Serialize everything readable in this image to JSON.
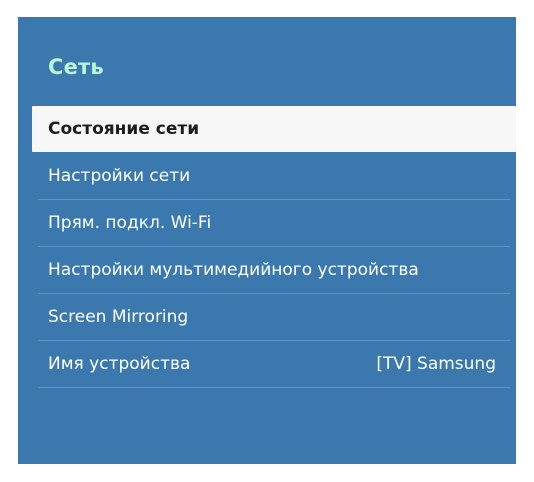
{
  "menu": {
    "title": "Сеть",
    "items": [
      {
        "label": "Состояние сети",
        "value": "",
        "selected": true
      },
      {
        "label": "Настройки сети",
        "value": ""
      },
      {
        "label": "Прям. подкл. Wi-Fi",
        "value": ""
      },
      {
        "label": "Настройки мультимедийного устройства",
        "value": ""
      },
      {
        "label": "Screen Mirroring",
        "value": ""
      },
      {
        "label": "Имя устройства",
        "value": "[TV] Samsung"
      }
    ]
  },
  "colors": {
    "panel_bg": "#3a78ad",
    "title": "#b9f5d8",
    "selected_bg": "#f7f7f7",
    "text": "#ffffff"
  }
}
